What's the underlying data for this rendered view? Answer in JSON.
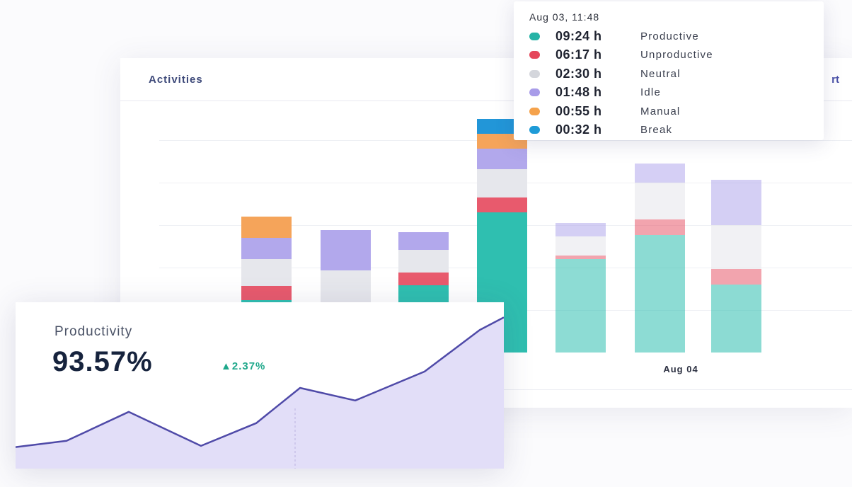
{
  "activities": {
    "title": "Activities",
    "title_right": "rt",
    "x_label": "Aug 04"
  },
  "tooltip": {
    "header": "Aug 03, 11:48",
    "rows": [
      {
        "time": "09:24 h",
        "label": "Productive",
        "color": "#26b3a6"
      },
      {
        "time": "06:17 h",
        "label": "Unproductive",
        "color": "#e5475b"
      },
      {
        "time": "02:30 h",
        "label": "Neutral",
        "color": "#d4d6dc"
      },
      {
        "time": "01:48 h",
        "label": "Idle",
        "color": "#a89ce9"
      },
      {
        "time": "00:55 h",
        "label": "Manual",
        "color": "#f5a24b"
      },
      {
        "time": "00:32 h",
        "label": "Break",
        "color": "#1e9bd7"
      }
    ]
  },
  "productivity": {
    "title": "Productivity",
    "value": "93.57%",
    "delta": "▲2.37%"
  },
  "colors": {
    "productive": "#2fbfb0",
    "unproductive": "#e85a6d",
    "neutral": "#e6e7ec",
    "idle": "#b2a8ec",
    "manual": "#f5a45a",
    "break": "#2296d8",
    "accent": "#4f4aa8",
    "area_fill": "#e2def8"
  },
  "chart_data": [
    {
      "type": "bar",
      "stacked": true,
      "series_order": [
        "productive",
        "unproductive",
        "neutral",
        "idle",
        "manual",
        "break"
      ],
      "bars": [
        {
          "productive": 74,
          "unproductive": 20,
          "neutral": 38,
          "idle": 30,
          "manual": 30,
          "break": 0,
          "faded": false
        },
        {
          "productive": 24,
          "unproductive": 22,
          "neutral": 70,
          "idle": 57,
          "manual": 0,
          "break": 0,
          "faded": false
        },
        {
          "productive": 95,
          "unproductive": 18,
          "neutral": 32,
          "idle": 25,
          "manual": 0,
          "break": 0,
          "faded": false
        },
        {
          "productive": 198,
          "unproductive": 21,
          "neutral": 40,
          "idle": 29,
          "manual": 21,
          "break": 21,
          "faded": false
        },
        {
          "productive": 132,
          "unproductive": 5,
          "neutral": 27,
          "idle": 19,
          "manual": 0,
          "break": 0,
          "faded": true
        },
        {
          "productive": 166,
          "unproductive": 22,
          "neutral": 52,
          "idle": 27,
          "manual": 0,
          "break": 0,
          "faded": true
        },
        {
          "productive": 96,
          "unproductive": 22,
          "neutral": 62,
          "idle": 64,
          "manual": 0,
          "break": 0,
          "faded": true
        }
      ]
    },
    {
      "type": "area",
      "values": [
        3,
        8,
        31,
        4,
        22,
        50,
        40,
        63,
        96,
        106
      ]
    }
  ]
}
